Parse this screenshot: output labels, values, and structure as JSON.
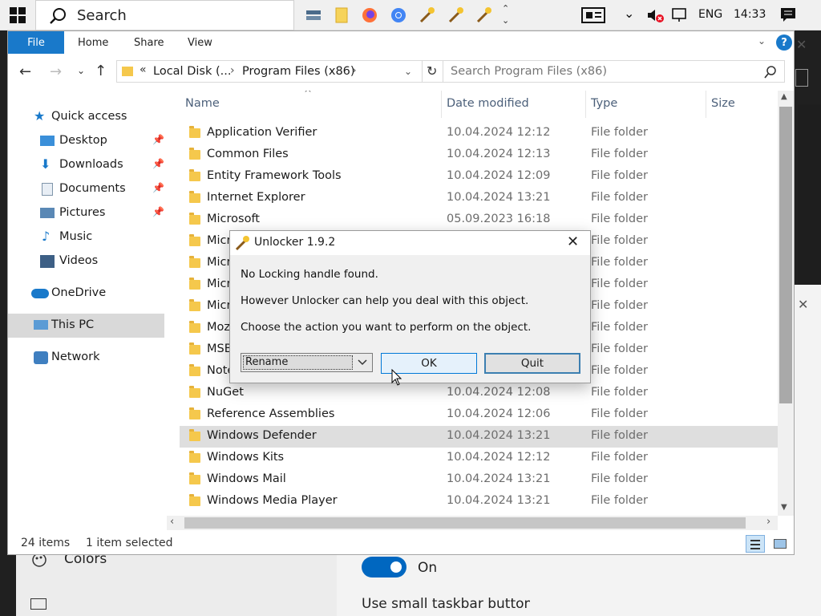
{
  "taskbar": {
    "search_placeholder": "Search",
    "language": "ENG",
    "time": "14:33"
  },
  "ribbon": {
    "tabs": [
      "File",
      "Home",
      "Share",
      "View"
    ]
  },
  "address": {
    "overflow": "«",
    "crumbs": [
      "Local Disk (...",
      "Program Files (x86)"
    ],
    "search_placeholder": "Search Program Files (x86)"
  },
  "nav": {
    "items": [
      {
        "label": "Quick access",
        "icon": "star-icon"
      },
      {
        "label": "Desktop",
        "icon": "desktop-icon",
        "pinned": true
      },
      {
        "label": "Downloads",
        "icon": "download-icon",
        "pinned": true
      },
      {
        "label": "Documents",
        "icon": "document-icon",
        "pinned": true
      },
      {
        "label": "Pictures",
        "icon": "picture-icon",
        "pinned": true
      },
      {
        "label": "Music",
        "icon": "music-icon"
      },
      {
        "label": "Videos",
        "icon": "video-icon"
      },
      {
        "label": "OneDrive",
        "icon": "cloud-icon"
      },
      {
        "label": "This PC",
        "icon": "pc-icon",
        "selected": true
      },
      {
        "label": "Network",
        "icon": "network-icon"
      }
    ]
  },
  "columns": {
    "name": "Name",
    "date": "Date modified",
    "type": "Type",
    "size": "Size"
  },
  "files": [
    {
      "name": "Application Verifier",
      "date": "10.04.2024 12:12",
      "type": "File folder"
    },
    {
      "name": "Common Files",
      "date": "10.04.2024 12:13",
      "type": "File folder"
    },
    {
      "name": "Entity Framework Tools",
      "date": "10.04.2024 12:09",
      "type": "File folder"
    },
    {
      "name": "Internet Explorer",
      "date": "10.04.2024 13:21",
      "type": "File folder"
    },
    {
      "name": "Microsoft",
      "date": "05.09.2023 16:18",
      "type": "File folder"
    },
    {
      "name": "Micr",
      "date": "",
      "type": "File folder"
    },
    {
      "name": "Micr",
      "date": "",
      "type": "File folder"
    },
    {
      "name": "Micr",
      "date": "",
      "type": "File folder"
    },
    {
      "name": "Micr",
      "date": "",
      "type": "File folder"
    },
    {
      "name": "Moz",
      "date": "",
      "type": "File folder"
    },
    {
      "name": "MSB",
      "date": "",
      "type": "File folder"
    },
    {
      "name": "Note",
      "date": "",
      "type": "File folder"
    },
    {
      "name": "NuGet",
      "date": "10.04.2024 12:08",
      "type": "File folder"
    },
    {
      "name": "Reference Assemblies",
      "date": "10.04.2024 12:06",
      "type": "File folder"
    },
    {
      "name": "Windows Defender",
      "date": "10.04.2024 13:21",
      "type": "File folder",
      "selected": true
    },
    {
      "name": "Windows Kits",
      "date": "10.04.2024 12:12",
      "type": "File folder"
    },
    {
      "name": "Windows Mail",
      "date": "10.04.2024 13:21",
      "type": "File folder"
    },
    {
      "name": "Windows Media Player",
      "date": "10.04.2024 13:21",
      "type": "File folder"
    }
  ],
  "status": {
    "count": "24 items",
    "selected": "1 item selected"
  },
  "dialog": {
    "title": "Unlocker 1.9.2",
    "line1": "No Locking handle found.",
    "line2": "However Unlocker can help you deal with this object.",
    "line3": "Choose the action you want to perform on the object.",
    "action_value": "Rename",
    "ok_label": "OK",
    "quit_label": "Quit"
  },
  "settings": {
    "colors_label": "Colors",
    "toggle_label": "On",
    "partial_text": "Use small taskbar buttons"
  },
  "colors": {
    "accent": "#0078d7",
    "file_tab": "#1979ca",
    "folder": "#f5c84c"
  }
}
